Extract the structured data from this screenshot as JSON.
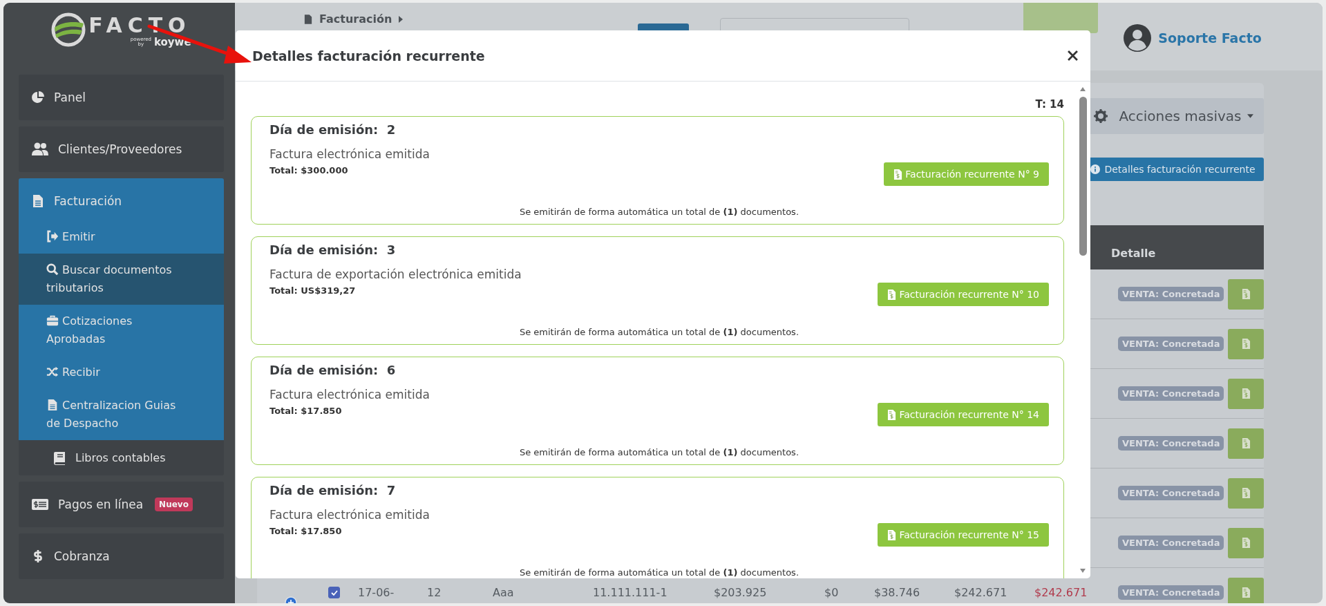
{
  "sidebar": {
    "logo": {
      "wordmark": "FACTO",
      "powered": "powered",
      "by": "by",
      "brand": "koywe"
    },
    "items": [
      {
        "label": "Panel",
        "kind": "item",
        "selected": false
      },
      {
        "label": "Clientes/Proveedores",
        "kind": "item",
        "selected": false
      },
      {
        "label": "Facturación",
        "kind": "group",
        "selected": true,
        "children": [
          {
            "label": "Emitir",
            "selected": false
          },
          {
            "label": "Buscar documentos tributarios",
            "selected": true
          },
          {
            "label": "Cotizaciones Aprobadas",
            "selected": false
          },
          {
            "label": "Recibir",
            "selected": false
          },
          {
            "label": "Centralizacion Guias de Despacho",
            "selected": false
          }
        ]
      },
      {
        "label": "Libros contables",
        "kind": "indented",
        "selected": false
      },
      {
        "label": "Pagos en línea",
        "kind": "item",
        "selected": false,
        "badge": "Nuevo"
      },
      {
        "label": "Cobranza",
        "kind": "item",
        "selected": false
      }
    ]
  },
  "header": {
    "breadcrumb": "Facturación",
    "user": "Soporte Facto"
  },
  "toolbar": {
    "bulk_actions": "Acciones masivas",
    "info_button": "Detalles facturación recurrente"
  },
  "table": {
    "header": "Detalle",
    "rows": [
      {
        "status": "VENTA: Concretada"
      },
      {
        "status": "VENTA: Concretada"
      },
      {
        "status": "VENTA: Concretada"
      },
      {
        "status": "VENTA: Concretada"
      },
      {
        "status": "VENTA: Concretada"
      },
      {
        "status": "VENTA: Concretada"
      },
      {
        "status": "VENTA: Concretada",
        "checked": true,
        "cells": [
          {
            "text": "17-06-",
            "kind": "plain"
          },
          {
            "text": "12",
            "kind": "plain"
          },
          {
            "text": "Aaa",
            "kind": "plain"
          },
          {
            "text": "11.111.111-1",
            "kind": "plain"
          },
          {
            "text": "$203.925",
            "kind": "plain"
          },
          {
            "text": "$0",
            "kind": "plain"
          },
          {
            "text": "$38.746",
            "kind": "plain"
          },
          {
            "text": "$242.671",
            "kind": "plain"
          },
          {
            "text": "$242.671",
            "kind": "due"
          }
        ]
      }
    ]
  },
  "modal": {
    "title": "Detalles facturación recurrente",
    "count": "T: 14",
    "cards": [
      {
        "day_label": "Día de emisión:",
        "day": "2",
        "document": "Factura electrónica emitida",
        "total": "Total: $300.000",
        "button": "Facturación recurrente N° 9",
        "note": "Se emitirán de forma automática un total de **(1)** documentos."
      },
      {
        "day_label": "Día de emisión:",
        "day": "3",
        "document": "Factura de exportación electrónica emitida",
        "total": "Total: US$319,27",
        "button": "Facturación recurrente N° 10",
        "note": "Se emitirán de forma automática un total de **(1)** documentos."
      },
      {
        "day_label": "Día de emisión:",
        "day": "6",
        "document": "Factura electrónica emitida",
        "total": "Total: $17.850",
        "button": "Facturación recurrente N° 14",
        "note": "Se emitirán de forma automática un total de **(1)** documentos."
      },
      {
        "day_label": "Día de emisión:",
        "day": "7",
        "document": "Factura electrónica emitida",
        "total": "Total: $17.850",
        "button": "Facturación recurrente N° 15",
        "note": "Se emitirán de forma automática un total de **(1)** documentos."
      }
    ]
  }
}
